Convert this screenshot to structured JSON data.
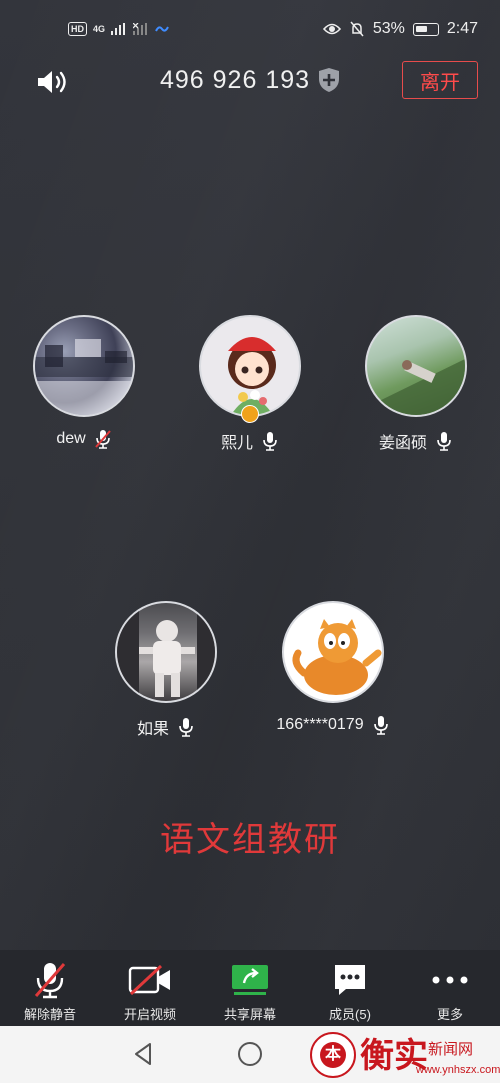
{
  "status_bar": {
    "network_badge": "HD",
    "network_type": "4G",
    "battery_percent": "53%",
    "time": "2:47"
  },
  "header": {
    "meeting_id": "496 926 193",
    "leave_label": "离开"
  },
  "participants": [
    {
      "name": "dew",
      "mic": "muted"
    },
    {
      "name": "熙儿",
      "mic": "on",
      "host": true
    },
    {
      "name": "姜函硕",
      "mic": "on"
    },
    {
      "name": "如果",
      "mic": "on"
    },
    {
      "name": "166****0179",
      "mic": "on"
    }
  ],
  "topic": "语文组教研",
  "toolbar": {
    "unmute_label": "解除静音",
    "video_label": "开启视频",
    "share_label": "共享屏幕",
    "members_label": "成员(5)",
    "more_label": "更多"
  },
  "watermark": {
    "seal_char": "本",
    "brand_big": "衡实",
    "brand_small": "新闻网",
    "url": "www.ynhszx.com"
  },
  "colors": {
    "background": "#2f3138",
    "leave_red": "#ff4b4b",
    "topic_red": "#e0393a",
    "share_green": "#2fb34a",
    "host_orange": "#f0a21b"
  }
}
